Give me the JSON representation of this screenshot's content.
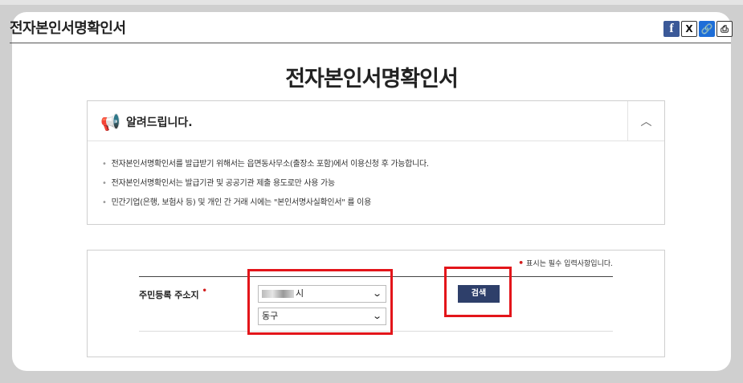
{
  "header": {
    "title": "전자본인서명확인서"
  },
  "share": {
    "facebook": "f",
    "x": "X",
    "link": "🔗",
    "print": "⎙"
  },
  "main": {
    "title": "전자본인서명확인서"
  },
  "notice": {
    "title": "알려드립니다.",
    "toggle_icon": "︿",
    "items": [
      "전자본인서명확인서를 발급받기 위해서는 읍면동사무소(출장소 포함)에서 이용신청 후 가능합니다.",
      "전자본인서명확인서는 발급기관 및 공공기관 제출 용도로만 사용 가능",
      "민간기업(은행, 보험사 등) 및 개인 간 거래 시에는 \"본인서명사실확인서\" 를 이용"
    ]
  },
  "form": {
    "required_note": "표시는 필수 입력사항입니다.",
    "required_mark": "•",
    "address_label": "주민등록 주소지",
    "city_select": {
      "value": "시"
    },
    "district_select": {
      "value": "동구"
    },
    "search_label": "검색"
  },
  "colors": {
    "button": "#2e3f6a",
    "required": "#d21e1e",
    "highlight_box": "#e3151a"
  }
}
